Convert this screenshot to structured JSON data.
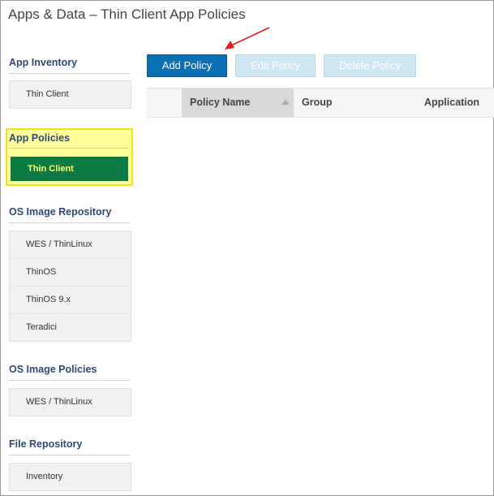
{
  "page_title": "Apps & Data – Thin Client App Policies",
  "sidebar": {
    "app_inventory": {
      "title": "App Inventory",
      "items": [
        "Thin Client"
      ]
    },
    "app_policies": {
      "title": "App Policies",
      "items": [
        "Thin Client"
      ],
      "active_item": "Thin Client"
    },
    "os_image_repository": {
      "title": "OS Image Repository",
      "items": [
        "WES / ThinLinux",
        "ThinOS",
        "ThinOS 9.x",
        "Teradici"
      ]
    },
    "os_image_policies": {
      "title": "OS Image Policies",
      "items": [
        "WES / ThinLinux"
      ]
    },
    "file_repository": {
      "title": "File Repository",
      "items": [
        "Inventory"
      ]
    }
  },
  "toolbar": {
    "add_label": "Add Policy",
    "edit_label": "Edit Policy",
    "delete_label": "Delete Policy"
  },
  "table": {
    "columns": [
      "Policy Name",
      "Group",
      "Application"
    ],
    "sorted_column": "Policy Name",
    "sort_direction": "ascending",
    "rows": []
  },
  "colors": {
    "primary_button": "#0b6fb3",
    "active_nav": "#0b7a45",
    "active_nav_text": "#ffff66",
    "highlight": "#ffff99",
    "annotation_arrow": "#e02020"
  }
}
